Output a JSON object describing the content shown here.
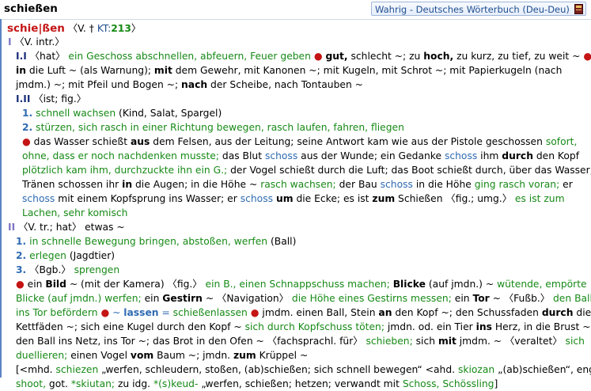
{
  "header": {
    "title": "schießen",
    "dictionary": "Wahrig - Deutsches Wörterbuch (Deu-Deu)",
    "book_icon": "book-icon"
  },
  "entry": {
    "hw_a": "schie",
    "hw_sep": "|",
    "hw_b": "ßen",
    "gram_open": "〈V. ",
    "cross": "†",
    "kt": "KT:",
    "kt_num": "213",
    "gram_close": "〉"
  },
  "lines": [
    [
      "I",
      " 〈V. intr.〉"
    ],
    [
      "I.I",
      " 〈hat〉 ",
      "ein Geschoss abschnellen, abfeuern, Feuer geben",
      " ● ",
      "gut,",
      " schlecht ~; zu ",
      "hoch,",
      " zu kurz, zu tief, zu weit ~ ",
      "●"
    ],
    [
      "in",
      " die Luft ~ (als Warnung); ",
      "mit",
      " dem Gewehr, mit Kanonen ~; mit Kugeln, mit Schrot ~; mit Papierkugeln (nach"
    ],
    [
      "jmdm.) ~; mit Pfeil und Bogen ~; ",
      "nach",
      " der Scheibe, nach Tontauben ~"
    ],
    [
      "I.II",
      " 〈ist; fig.〉"
    ],
    [
      "1.",
      " ",
      "schnell wachsen",
      " (Kind, Salat, Spargel)"
    ],
    [
      "2.",
      " ",
      "stürzen, sich rasch in einer Richtung bewegen, rasch laufen, fahren, fliegen"
    ],
    [
      "●",
      " das Wasser schießt ",
      "aus",
      " dem Felsen, aus der Leitung; seine Antwort kam wie aus der Pistole geschossen ",
      "sofort,"
    ],
    [
      "ohne, dass er noch nachdenken musste;",
      " das Blut ",
      "schoss",
      " aus der Wunde; ein Gedanke ",
      "schoss",
      " ihm ",
      "durch",
      " den Kopf"
    ],
    [
      "plötzlich kam ihm, durchzuckte ihn ein G.;",
      " der Vogel schießt durch die Luft; das Boot schießt durch, über das Wasser;"
    ],
    [
      "Tränen schossen ihr ",
      "in",
      " die Augen; in die Höhe ~ ",
      "rasch wachsen;",
      " der Bau ",
      "schoss",
      " in die Höhe ",
      "ging rasch voran;",
      " er"
    ],
    [
      "schoss",
      " mit einem Kopfsprung ins Wasser; er ",
      "schoss",
      " ",
      "um",
      " die Ecke; es ist ",
      "zum",
      " Schießen 〈fig.; umg.〉 ",
      "es ist zum"
    ],
    [
      "Lachen, sehr komisch"
    ],
    [
      "II",
      " 〈V. tr.; hat〉 etwas ~"
    ],
    [
      "1.",
      " ",
      "in schnelle Bewegung bringen, abstoßen, werfen",
      " (Ball)"
    ],
    [
      "2.",
      " ",
      "erlegen",
      " (Jagdtier)"
    ],
    [
      "3.",
      " 〈Bgb.〉 ",
      "sprengen"
    ],
    [
      "●",
      " ein ",
      "Bild",
      " ~ (mit der Kamera) 〈fig.〉 ",
      "ein B., einen Schnappschuss machen;",
      " ",
      "Blicke",
      " (auf jmdn.) ~ ",
      "wütende, empörte"
    ],
    [
      "Blicke (auf jmdn.) werfen;",
      " ein ",
      "Gestirn",
      " ~ 〈Navigation〉 ",
      "die Höhe eines Gestirns messen;",
      " ein ",
      "Tor",
      " ~ 〈Fußb.〉 ",
      "den Ball"
    ],
    [
      "ins Tor befördern",
      " ",
      "●",
      " ~ ",
      "lassen",
      " = ",
      "schießenlassen",
      " ",
      "●",
      " jmdm. einen Ball, Stein ",
      "an",
      " den Kopf ~; den Schussfaden ",
      "durch",
      " die"
    ],
    [
      "Kettfäden ~; sich eine Kugel durch den Kopf ~ ",
      "sich durch Kopfschuss töten;",
      " jmdn. od. ein Tier ",
      "ins",
      " Herz, in die Brust ~;"
    ],
    [
      "den Ball ins Netz, ins Tor ~; das Brot in den Ofen ~ 〈fachsprachl. für〉 ",
      "schieben;",
      " sich ",
      "mit",
      " jmdm. ~ 〈veraltet〉 ",
      "sich"
    ],
    [
      "duellieren;",
      " einen Vogel ",
      "vom",
      " Baum ~; jmdn. ",
      "zum",
      " Krüppel ~"
    ],
    [
      "[<mhd. ",
      "schiezen",
      " „werfen, schleudern, stoßen, (ab)schießen; sich schnell bewegen“ <ahd. ",
      "skiozan",
      " „(ab)schießen“, engl."
    ],
    [
      "shoot,",
      " got. ",
      "*skiutan;",
      " zu idg. ",
      "*(s)keud-",
      " „werfen, schießen; hetzen; verwandt mit ",
      "Schoss, Schössling",
      "]"
    ]
  ]
}
